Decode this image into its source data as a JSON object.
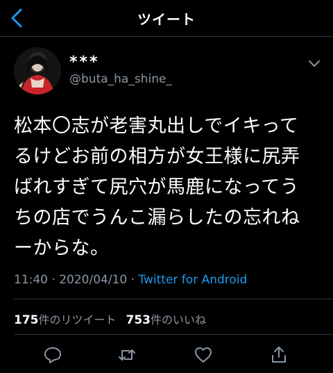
{
  "header": {
    "title": "ツイート",
    "back_icon": "chevron-left-icon"
  },
  "tweet": {
    "display_name": "***",
    "handle": "@buta_ha_shine_",
    "text": "松本〇志が老害丸出しでイキって\nるけどお前の相方が女王様に尻弄\nばれすぎて尻穴が馬鹿になってう\nちの店でうんこ漏らしたの忘れね\nーからな。",
    "time": "11:40",
    "date": "2020/04/10",
    "separator": "·",
    "client": "Twitter for Android"
  },
  "stats": {
    "retweets_count": "175",
    "retweets_label": "件のリツイート",
    "likes_count": "753",
    "likes_label": "件のいいね"
  },
  "actions": [
    "reply-icon",
    "retweet-icon",
    "like-icon",
    "share-icon"
  ],
  "colors": {
    "background": "#000000",
    "text": "#ffffff",
    "secondary_text": "#8b98a5",
    "accent": "#1d9bf0",
    "divider": "#2f3336"
  }
}
